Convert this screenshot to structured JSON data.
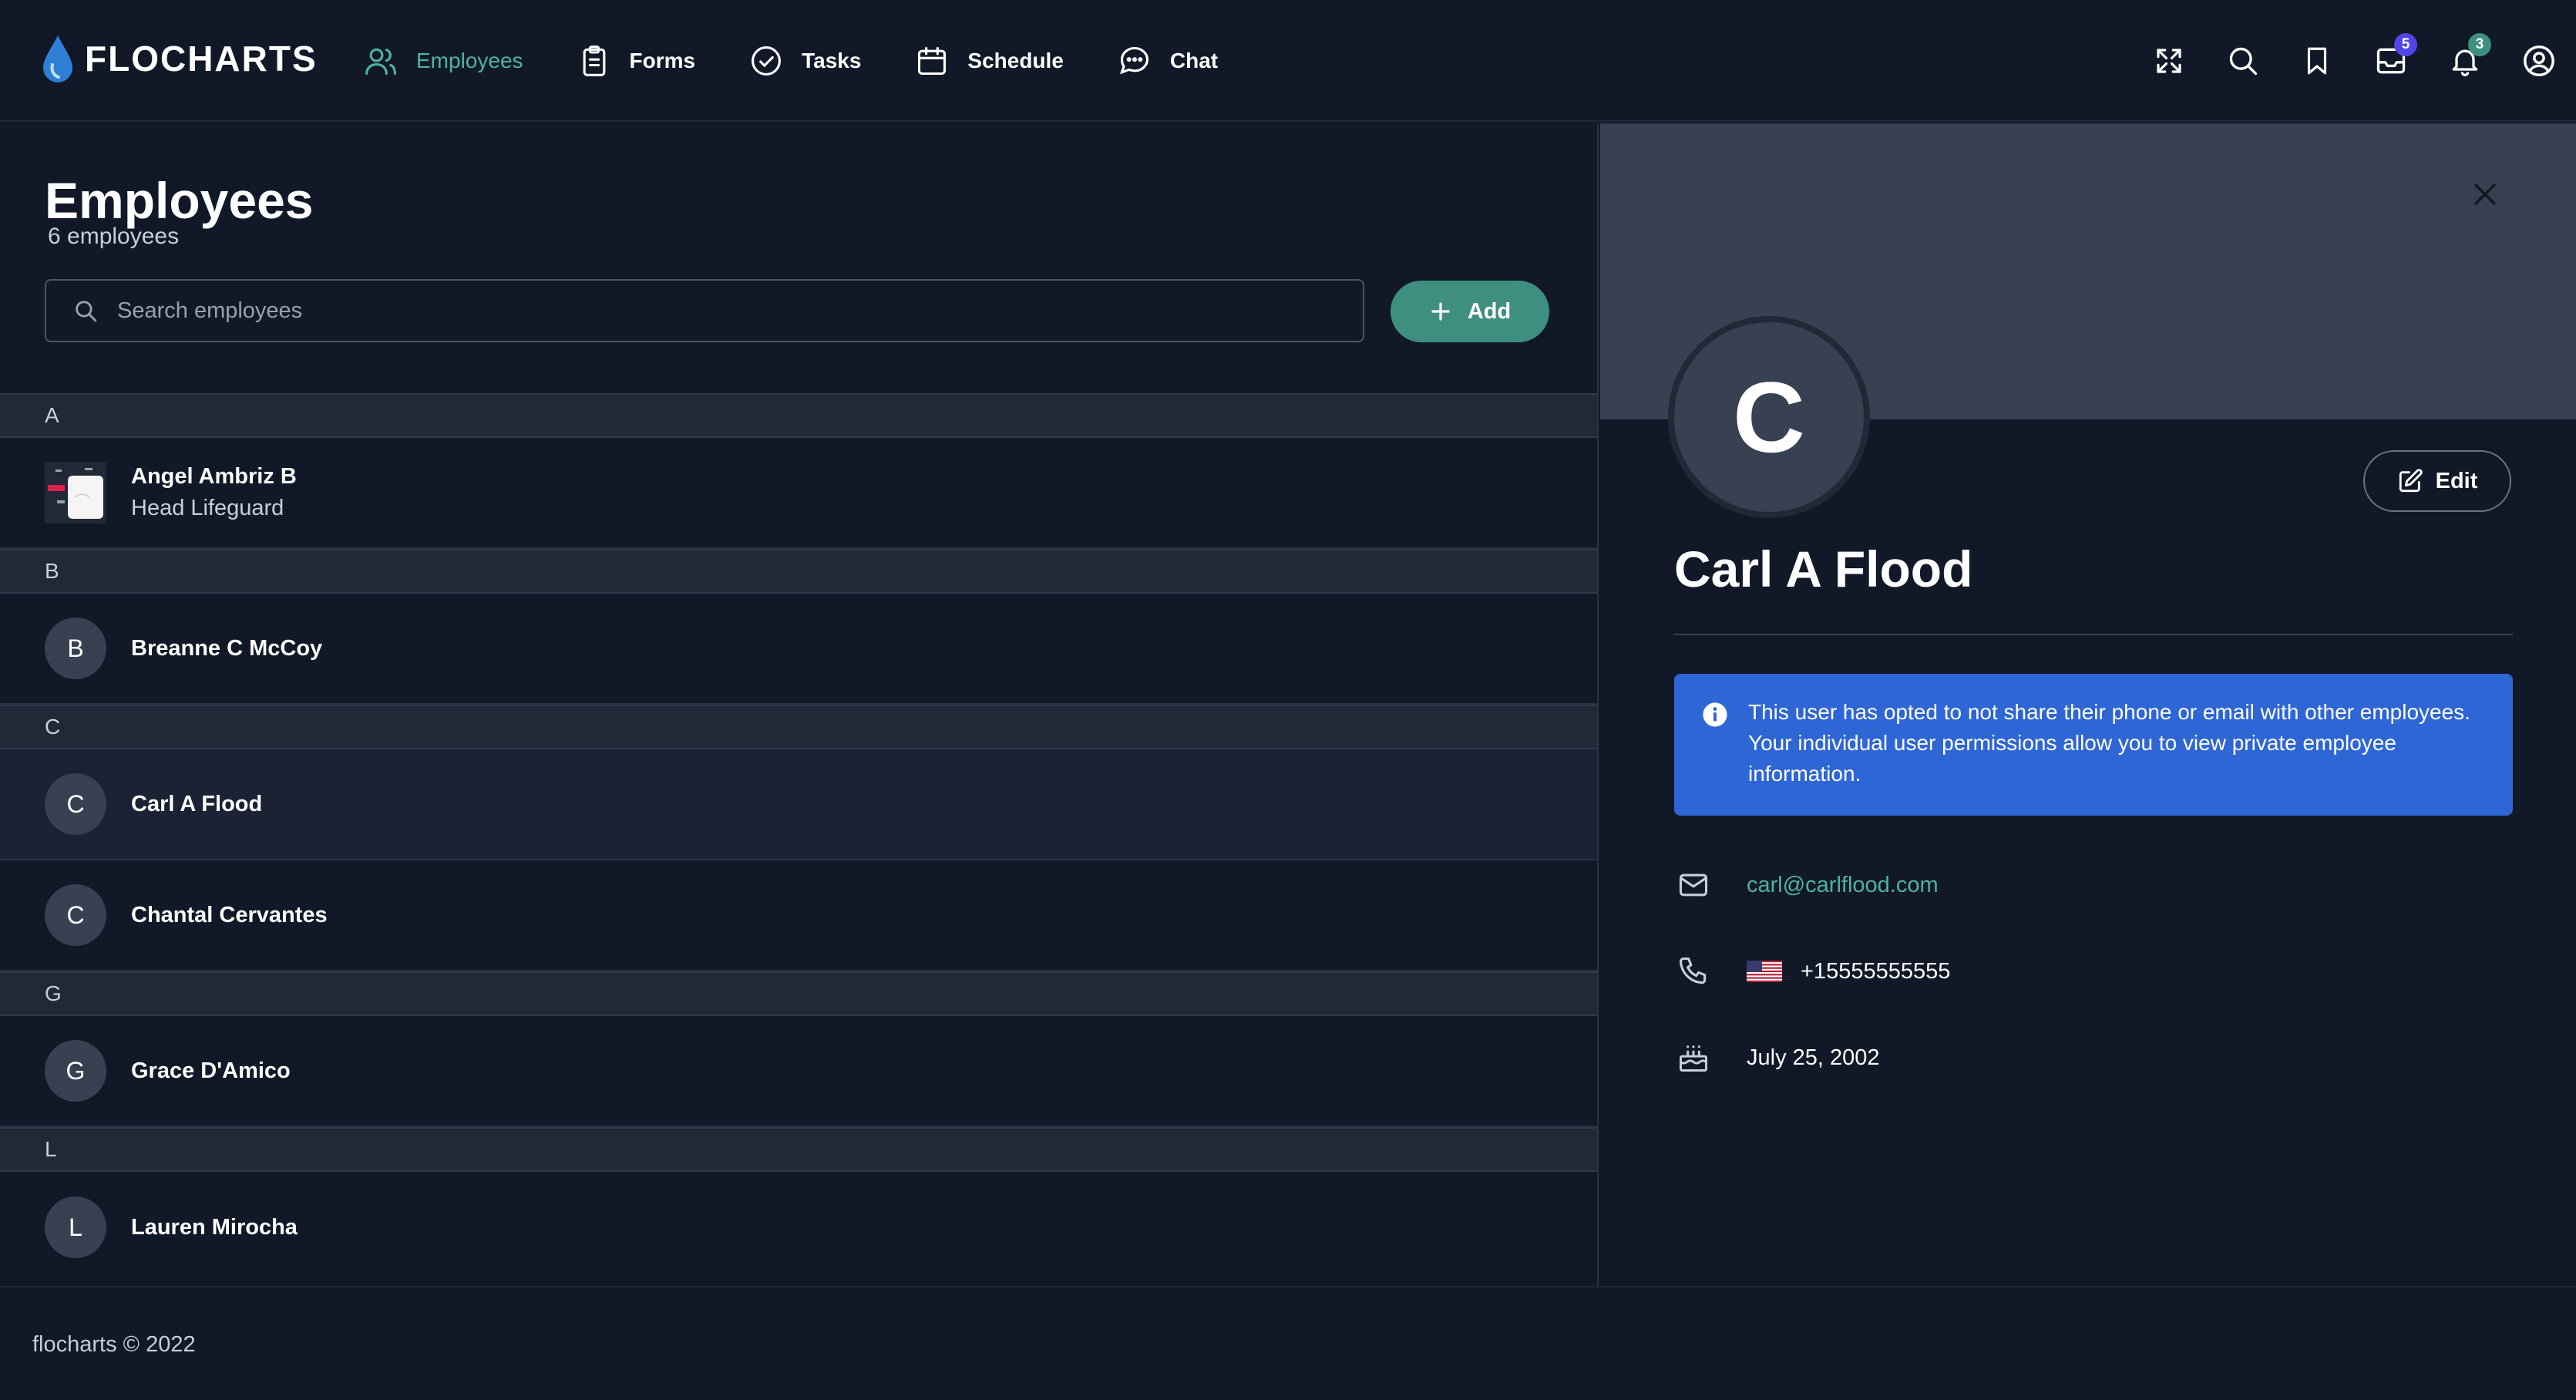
{
  "brand": {
    "name": "FLOCHARTS",
    "accent": "#4fb3a0"
  },
  "nav": {
    "items": [
      {
        "label": "Employees",
        "icon": "users-icon",
        "active": true
      },
      {
        "label": "Forms",
        "icon": "clipboard-icon",
        "active": false
      },
      {
        "label": "Tasks",
        "icon": "check-circle-icon",
        "active": false
      },
      {
        "label": "Schedule",
        "icon": "calendar-icon",
        "active": false
      },
      {
        "label": "Chat",
        "icon": "chat-bubble-icon",
        "active": false
      }
    ],
    "right_icons": [
      "expand-icon",
      "search-icon",
      "bookmark-icon",
      "inbox-icon",
      "bell-icon",
      "user-circle-icon"
    ],
    "inbox_badge": "5",
    "bell_badge": "3"
  },
  "employees_page": {
    "title": "Employees",
    "count_text": "6 employees",
    "search_placeholder": "Search employees",
    "add_label": "Add",
    "groups": [
      {
        "letter": "A",
        "people": [
          {
            "name": "Angel Ambriz B",
            "title": "Head Lifeguard",
            "initial": ""
          }
        ]
      },
      {
        "letter": "B",
        "people": [
          {
            "name": "Breanne C McCoy",
            "title": "",
            "initial": "B"
          }
        ]
      },
      {
        "letter": "C",
        "people": [
          {
            "name": "Carl A Flood",
            "title": "",
            "initial": "C"
          },
          {
            "name": "Chantal Cervantes",
            "title": "",
            "initial": "C"
          }
        ]
      },
      {
        "letter": "G",
        "people": [
          {
            "name": "Grace D'Amico",
            "title": "",
            "initial": "G"
          }
        ]
      },
      {
        "letter": "L",
        "people": [
          {
            "name": "Lauren Mirocha",
            "title": "",
            "initial": "L"
          }
        ]
      }
    ]
  },
  "profile": {
    "initial": "C",
    "name": "Carl A Flood",
    "edit_label": "Edit",
    "alert": "This user has opted to not share their phone or email with other employees. Your individual user permissions allow you to view private employee information.",
    "email": "carl@carlflood.com",
    "phone": "+15555555555",
    "birthday": "July 25, 2002"
  },
  "footer": {
    "text": "flocharts © 2022"
  }
}
